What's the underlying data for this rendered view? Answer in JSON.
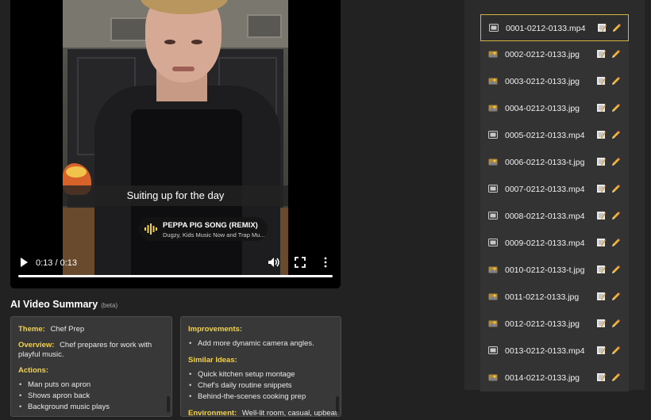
{
  "video": {
    "caption": "Suiting up for the day",
    "music_title": "PEPPA PIG SONG (REMIX)",
    "music_artist": "Dugzy, Kids Music Now and Trap Mu...",
    "time": "0:13 / 0:13",
    "progress": 1.0
  },
  "summary": {
    "title": "AI Video Summary",
    "beta": "(beta)",
    "theme_label": "Theme:",
    "theme_value": "Chef Prep",
    "overview_label": "Overview:",
    "overview_value": "Chef prepares for work with playful music.",
    "actions_label": "Actions:",
    "actions": [
      "Man puts on apron",
      "Shows apron back",
      "Background music plays"
    ],
    "improvements_label": "Improvements:",
    "improvements": [
      "Add more dynamic camera angles."
    ],
    "similar_label": "Similar Ideas:",
    "similar": [
      "Quick kitchen setup montage",
      "Chef's daily routine snippets",
      "Behind-the-scenes cooking prep"
    ],
    "environment_label": "Environment:",
    "environment_value": "Well-lit room, casual, upbeat"
  },
  "files": [
    {
      "name": "0001-0212-0133.mp4",
      "type": "video-file-icon",
      "selected": true
    },
    {
      "name": "0002-0212-0133.jpg",
      "type": "image-file-icon",
      "selected": false
    },
    {
      "name": "0003-0212-0133.jpg",
      "type": "image-file-icon",
      "selected": false
    },
    {
      "name": "0004-0212-0133.jpg",
      "type": "image-file-icon",
      "selected": false
    },
    {
      "name": "0005-0212-0133.mp4",
      "type": "video-file-icon",
      "selected": false
    },
    {
      "name": "0006-0212-0133-t.jpg",
      "type": "image-file-icon",
      "selected": false
    },
    {
      "name": "0007-0212-0133.mp4",
      "type": "video-file-icon",
      "selected": false
    },
    {
      "name": "0008-0212-0133.mp4",
      "type": "video-file-icon",
      "selected": false
    },
    {
      "name": "0009-0212-0133.mp4",
      "type": "video-file-icon",
      "selected": false
    },
    {
      "name": "0010-0212-0133-t.jpg",
      "type": "image-file-icon",
      "selected": false
    },
    {
      "name": "0011-0212-0133.jpg",
      "type": "image-file-icon",
      "selected": false
    },
    {
      "name": "0012-0212-0133.jpg",
      "type": "image-file-icon",
      "selected": false
    },
    {
      "name": "0013-0212-0133.mp4",
      "type": "video-file-icon",
      "selected": false
    },
    {
      "name": "0014-0212-0133.jpg",
      "type": "image-file-icon",
      "selected": false
    }
  ],
  "colors": {
    "accent": "#f3d24a",
    "selected_border": "#d4b43a"
  }
}
